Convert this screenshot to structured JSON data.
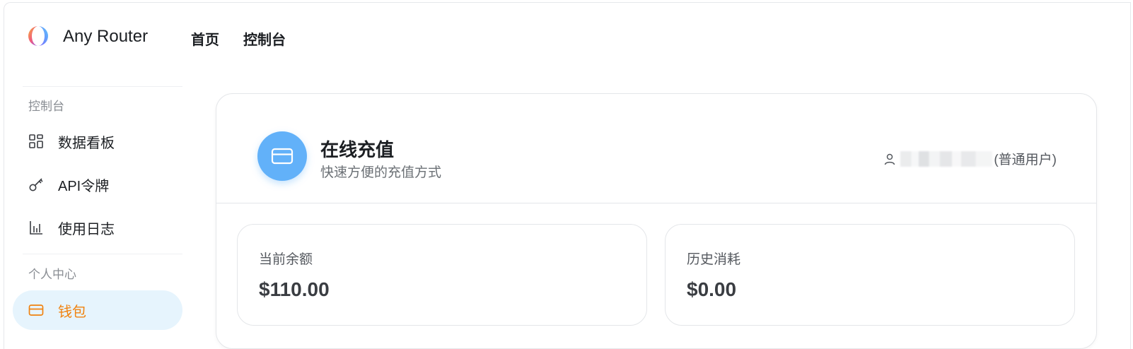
{
  "header": {
    "brand": "Any Router",
    "nav": [
      "首页",
      "控制台"
    ]
  },
  "sidebar": {
    "section_console": "控制台",
    "items": [
      {
        "label": "数据看板",
        "icon": "dashboard-grid-icon"
      },
      {
        "label": "API令牌",
        "icon": "key-icon"
      },
      {
        "label": "使用日志",
        "icon": "bar-chart-icon"
      }
    ],
    "section_personal": "个人中心",
    "active_item": {
      "label": "钱包",
      "icon": "credit-card-icon"
    }
  },
  "topup": {
    "title": "在线充值",
    "subtitle": "快速方便的充值方式",
    "user_role": "(普通用户)",
    "balance_label": "当前余额",
    "balance_value": "$110.00",
    "history_label": "历史消耗",
    "history_value": "$0.00"
  },
  "colors": {
    "accent_orange": "#f0820f",
    "active_bg": "#e6f4fd",
    "icon_blue": "#62b1f9"
  }
}
